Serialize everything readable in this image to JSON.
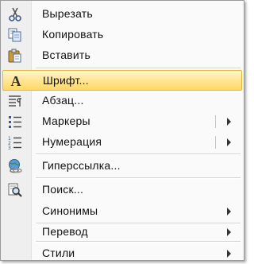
{
  "menu": {
    "items": [
      {
        "label": "Вырезать",
        "icon": "scissors-icon"
      },
      {
        "label": "Копировать",
        "icon": "copy-icon"
      },
      {
        "label": "Вставить",
        "icon": "paste-icon"
      },
      {
        "label": "Шрифт...",
        "icon": "font-icon",
        "icon_glyph": "A"
      },
      {
        "label": "Абзац...",
        "icon": "paragraph-icon"
      },
      {
        "label": "Маркеры",
        "icon": "bullets-icon"
      },
      {
        "label": "Нумерация",
        "icon": "numbering-icon"
      },
      {
        "label": "Гиперссылка...",
        "icon": "hyperlink-icon"
      },
      {
        "label": "Поиск...",
        "icon": "search-icon"
      },
      {
        "label": "Синонимы",
        "icon": ""
      },
      {
        "label": "Перевод",
        "icon": ""
      },
      {
        "label": "Стили",
        "icon": ""
      }
    ],
    "highlight_color": "#ffe79a"
  }
}
